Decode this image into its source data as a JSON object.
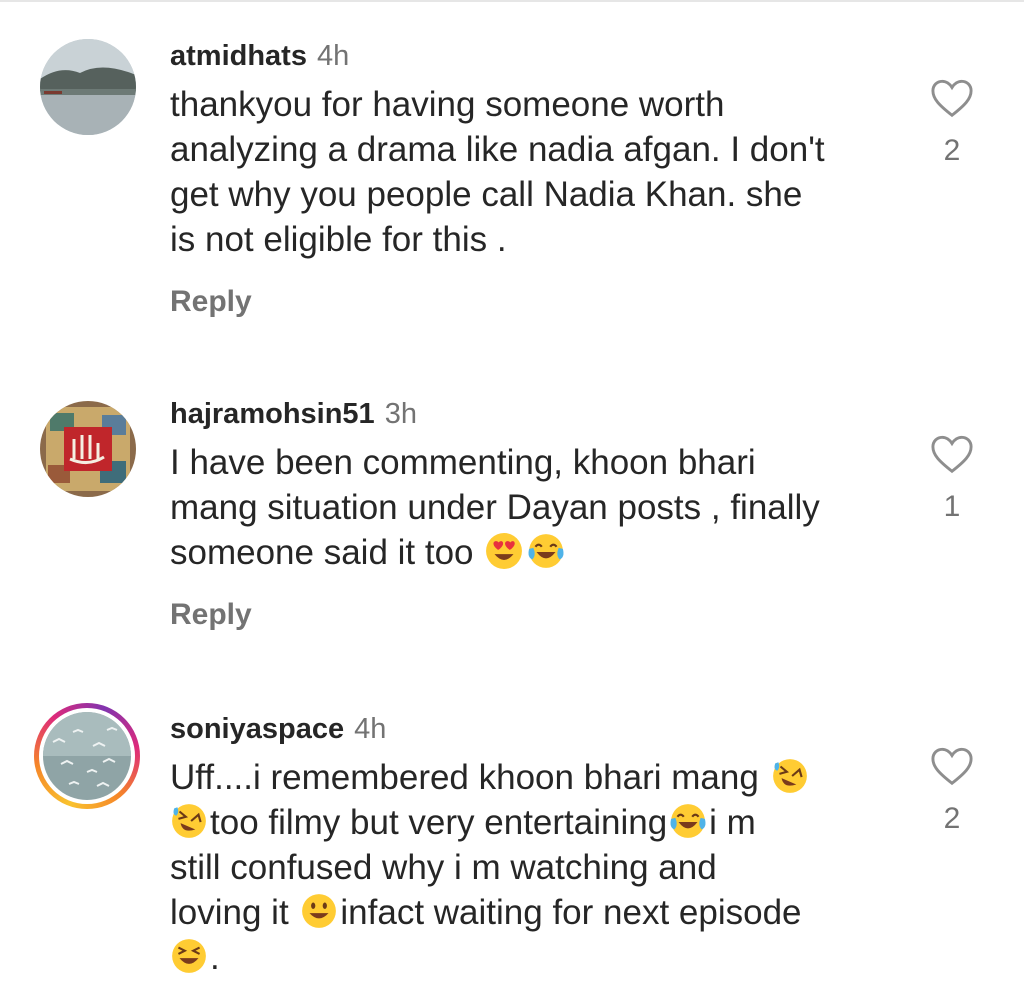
{
  "comments": [
    {
      "username": "atmidhats",
      "time": "4h",
      "lines": [
        "thankyou for having someone worth",
        "analyzing a drama like nadia afgan. I don't",
        "get why you people call Nadia Khan. she",
        "is not eligible for this ."
      ],
      "reply_label": "Reply",
      "likes": "2",
      "avatar_icon": "lake-landscape-avatar"
    },
    {
      "username": "hajramohsin51",
      "time": "3h",
      "lines": [
        "I have been commenting, khoon bhari",
        "mang situation under Dayan posts , finally",
        "someone said it too"
      ],
      "emoji_line3": [
        "heart-eyes-emoji",
        "tears-of-joy-emoji"
      ],
      "reply_label": "Reply",
      "likes": "1",
      "avatar_icon": "calligraphy-avatar"
    },
    {
      "username": "soniyaspace",
      "time": "4h",
      "lines": [
        "Uff....i remembered khoon bhari mang",
        "too filmy but very entertaining",
        "i m",
        "still confused why i m watching and",
        "loving it",
        "infact waiting for next episode",
        "."
      ],
      "emoji_names": [
        "rolling-laughing-emoji",
        "rolling-laughing-emoji",
        "tears-of-joy-emoji",
        "grinning-emoji",
        "laughing-squint-emoji"
      ],
      "likes": "2",
      "avatar_icon": "birds-sky-avatar",
      "story_ring": true
    }
  ],
  "colors": {
    "text": "#262626",
    "secondary": "#737373",
    "heart_outline": "#8e8e8e"
  }
}
